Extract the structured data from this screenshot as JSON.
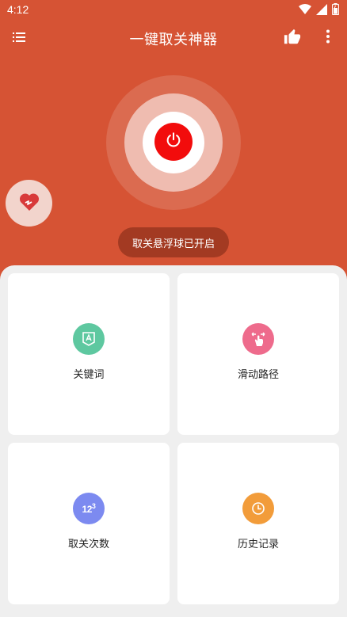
{
  "status_bar": {
    "time": "4:12",
    "icons": [
      "wifi-icon",
      "signal-icon",
      "battery-icon"
    ]
  },
  "app_bar": {
    "title": "一键取关神器",
    "icons": [
      "menu-icon",
      "thumbs-up-icon",
      "more-vert-icon"
    ]
  },
  "power": {
    "icon": "power-icon",
    "color": "#f20c0c"
  },
  "floating": {
    "icon": "heart-icon"
  },
  "toast": {
    "text": "取关悬浮球已开启"
  },
  "cards": [
    {
      "label": "关键词",
      "icon": "keyword-icon",
      "color": "#5ec8a0"
    },
    {
      "label": "滑动路径",
      "icon": "swipe-gesture-icon",
      "color": "#ee6b8c"
    },
    {
      "label": "取关次数",
      "icon": "count-123-icon",
      "color": "#7c8af0"
    },
    {
      "label": "历史记录",
      "icon": "clock-icon",
      "color": "#f29c3a"
    }
  ],
  "colors": {
    "brand": "#d65334",
    "panel": "#efefef"
  }
}
